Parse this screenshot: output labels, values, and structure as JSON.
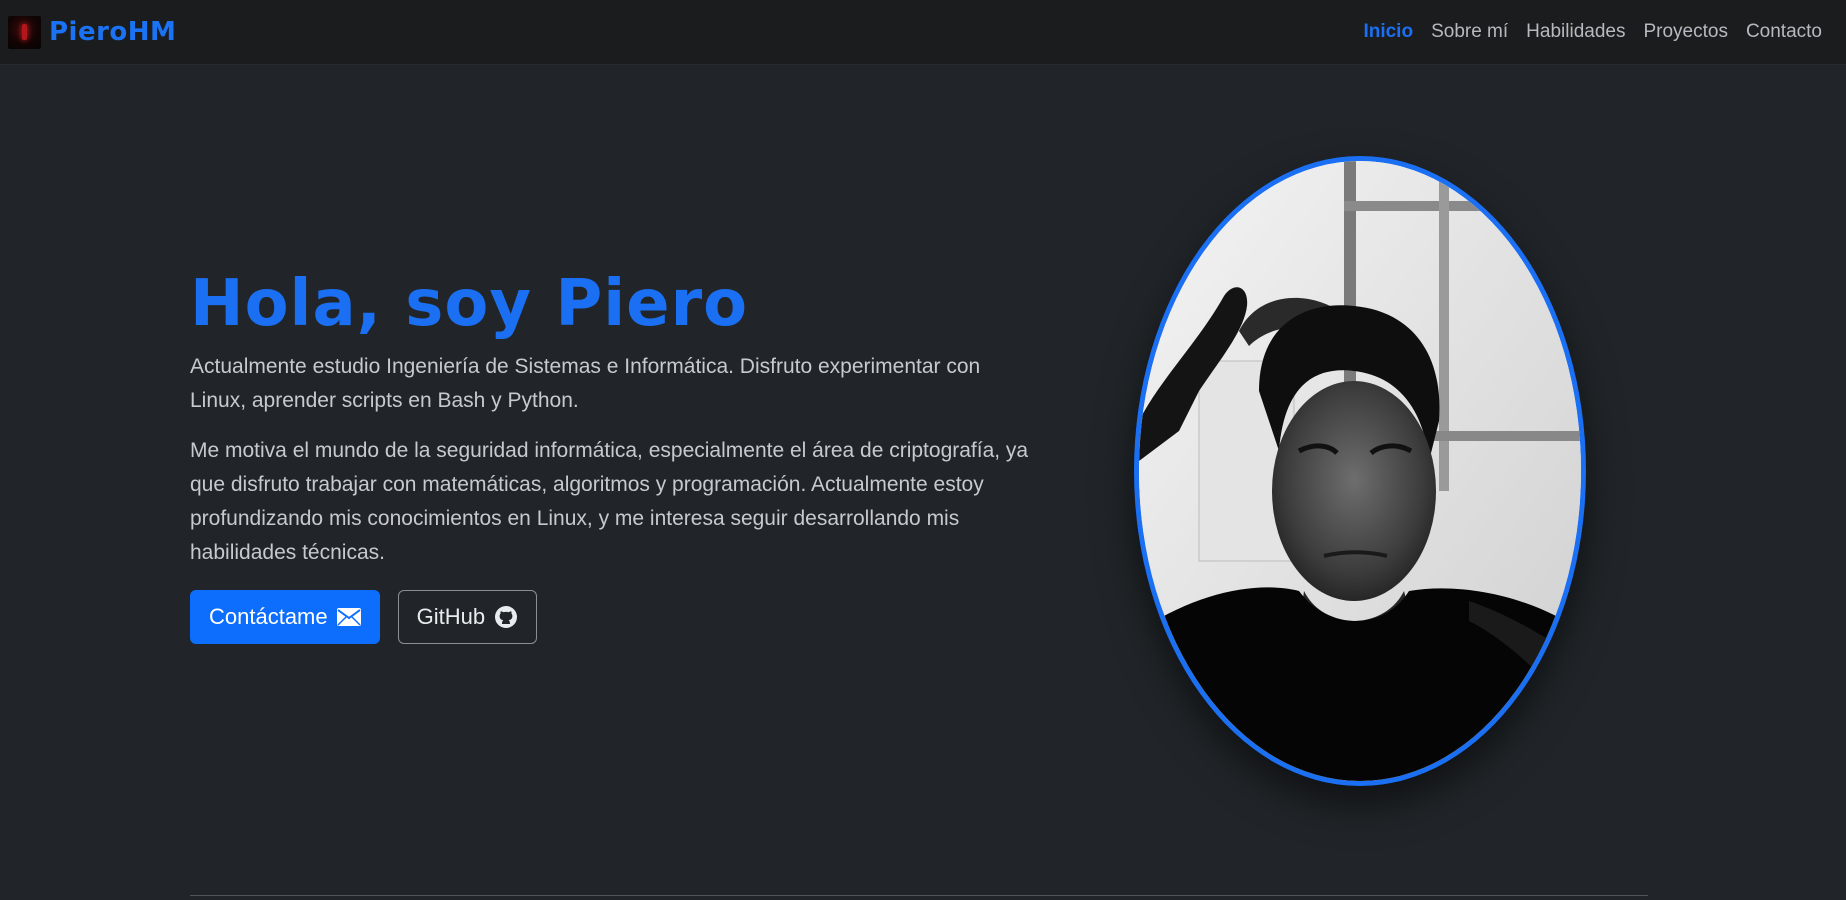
{
  "brand": {
    "name": "PieroHM",
    "color": "#1a73f5"
  },
  "nav": {
    "items": [
      {
        "label": "Inicio",
        "active": true
      },
      {
        "label": "Sobre mí",
        "active": false
      },
      {
        "label": "Habilidades",
        "active": false
      },
      {
        "label": "Proyectos",
        "active": false
      },
      {
        "label": "Contacto",
        "active": false
      }
    ]
  },
  "hero": {
    "title": "Hola, soy Piero",
    "paragraph1": "Actualmente estudio Ingeniería de Sistemas e Informática. Disfruto experimentar con Linux, aprender scripts en Bash y Python.",
    "paragraph2": "Me motiva el mundo de la seguridad informática, especialmente el área de criptografía, ya que disfruto trabajar con matemáticas, algoritmos y programación. Actualmente estoy profundizando mis conocimientos en Linux, y me interesa seguir desarrollando mis habilidades técnicas.",
    "contact_button": "Contáctame",
    "contact_icon": "envelope-icon",
    "github_button": "GitHub",
    "github_icon": "github-icon"
  },
  "colors": {
    "accent": "#0d6efd",
    "background": "#212529",
    "navbar": "#1b1c1e"
  }
}
